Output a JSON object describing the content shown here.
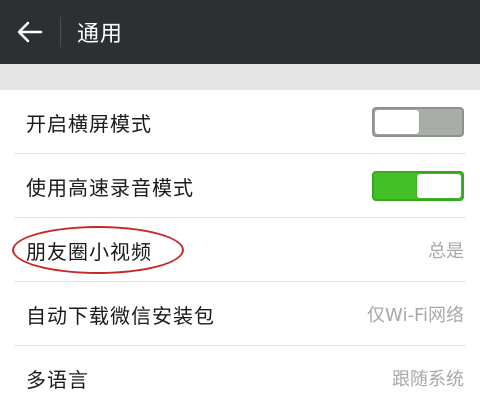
{
  "header": {
    "title": "通用"
  },
  "settings": [
    {
      "label": "开启横屏模式",
      "type": "toggle",
      "state": "off"
    },
    {
      "label": "使用高速录音模式",
      "type": "toggle",
      "state": "on"
    },
    {
      "label": "朋友圈小视频",
      "type": "value",
      "value": "总是"
    },
    {
      "label": "自动下载微信安装包",
      "type": "value",
      "value": "仅Wi-Fi网络"
    },
    {
      "label": "多语言",
      "type": "value",
      "value": "跟随系统"
    }
  ],
  "colors": {
    "header_bg": "#2d3032",
    "toggle_on": "#45bf27",
    "toggle_off": "#a9ada8",
    "annotation": "#c62828"
  },
  "icons": {
    "back": "arrow-left-icon"
  }
}
